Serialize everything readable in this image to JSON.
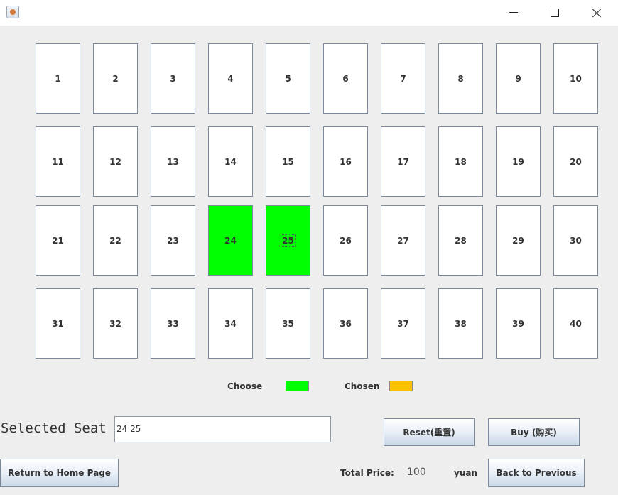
{
  "window": {
    "icon": "java-cup-icon",
    "controls": [
      "minimize-icon",
      "maximize-icon",
      "close-icon"
    ]
  },
  "seats": [
    {
      "label": "1"
    },
    {
      "label": "2"
    },
    {
      "label": "3"
    },
    {
      "label": "4"
    },
    {
      "label": "5"
    },
    {
      "label": "6"
    },
    {
      "label": "7"
    },
    {
      "label": "8"
    },
    {
      "label": "9"
    },
    {
      "label": "10"
    },
    {
      "label": "11"
    },
    {
      "label": "12"
    },
    {
      "label": "13"
    },
    {
      "label": "14"
    },
    {
      "label": "15"
    },
    {
      "label": "16"
    },
    {
      "label": "17"
    },
    {
      "label": "18"
    },
    {
      "label": "19"
    },
    {
      "label": "20"
    },
    {
      "label": "21"
    },
    {
      "label": "22"
    },
    {
      "label": "23"
    },
    {
      "label": "24"
    },
    {
      "label": "25"
    },
    {
      "label": "26"
    },
    {
      "label": "27"
    },
    {
      "label": "28"
    },
    {
      "label": "29"
    },
    {
      "label": "30"
    },
    {
      "label": "31"
    },
    {
      "label": "32"
    },
    {
      "label": "33"
    },
    {
      "label": "34"
    },
    {
      "label": "35"
    },
    {
      "label": "36"
    },
    {
      "label": "37"
    },
    {
      "label": "38"
    },
    {
      "label": "39"
    },
    {
      "label": "40"
    }
  ],
  "selected_seats": [
    "24",
    "25"
  ],
  "legend": {
    "choose_label": "Choose",
    "choose_color": "#00ff00",
    "chosen_label": "Chosen",
    "chosen_color": "#ffc000"
  },
  "selection": {
    "label": "Selected Seat",
    "value": "24 25"
  },
  "buttons": {
    "reset": "Reset(重置)",
    "buy": "Buy  (购买)",
    "home": "Return to Home Page",
    "back": "Back to Previous"
  },
  "price": {
    "label": "Total Price:",
    "value": "100",
    "unit": "yuan"
  }
}
